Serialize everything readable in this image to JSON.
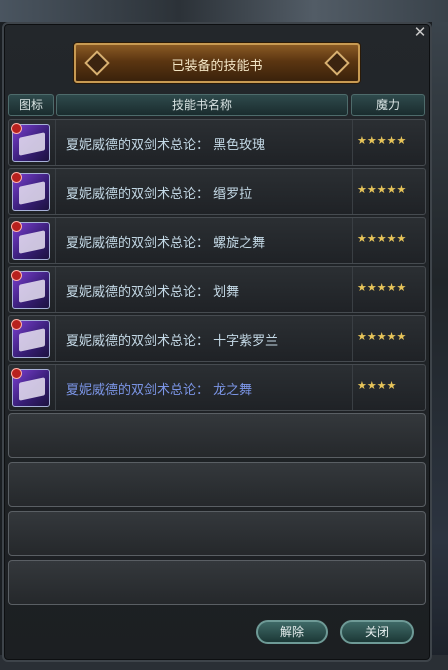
{
  "window": {
    "title": "已装备的技能书",
    "close_glyph": "✕"
  },
  "columns": {
    "icon": "图标",
    "name": "技能书名称",
    "mana": "魔力"
  },
  "rows": [
    {
      "name": "夏妮威德的双剑术总论： 黑色玫瑰",
      "stars": "★★★★★",
      "rating": 5,
      "color": "#c4d9e6"
    },
    {
      "name": "夏妮威德的双剑术总论： 缗罗拉",
      "stars": "★★★★★",
      "rating": 5,
      "color": "#c4d9e6"
    },
    {
      "name": "夏妮威德的双剑术总论： 螺旋之舞",
      "stars": "★★★★★",
      "rating": 5,
      "color": "#c4d9e6"
    },
    {
      "name": "夏妮威德的双剑术总论： 划舞",
      "stars": "★★★★★",
      "rating": 5,
      "color": "#c4d9e6"
    },
    {
      "name": "夏妮威德的双剑术总论： 十字紫罗兰",
      "stars": "★★★★★",
      "rating": 5,
      "color": "#c4d9e6"
    },
    {
      "name": "夏妮威德的双剑术总论： 龙之舞",
      "stars": "★★★★",
      "rating": 4,
      "color": "#7b95e6"
    }
  ],
  "icon_name": "skill-book-icon",
  "buttons": {
    "remove": "解除",
    "close": "关闭"
  }
}
